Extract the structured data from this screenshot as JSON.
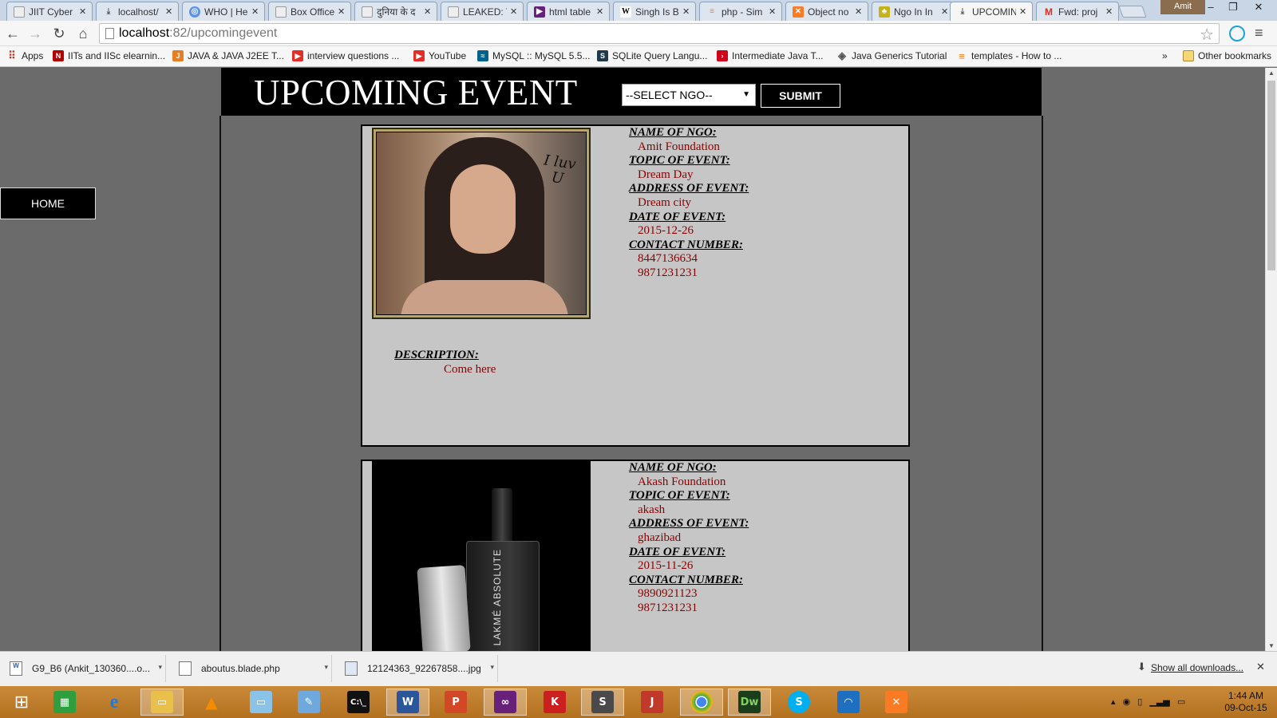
{
  "browser": {
    "tabs": [
      {
        "label": "JIIT Cyber",
        "icon": "page-icon",
        "color": "#eeeeee"
      },
      {
        "label": "localhost/",
        "icon": "download-page-icon",
        "color": "#eeeeee"
      },
      {
        "label": "WHO | He",
        "icon": "who-icon",
        "color": "#5b92e5"
      },
      {
        "label": "Box Office",
        "icon": "page-icon",
        "color": "#eeeeee"
      },
      {
        "label": "दुनिया के द",
        "icon": "page-icon",
        "color": "#eeeeee"
      },
      {
        "label": "LEAKED: T",
        "icon": "page-icon",
        "color": "#eeeeee"
      },
      {
        "label": "html table",
        "icon": "visual-studio-icon",
        "color": "#68217a"
      },
      {
        "label": "Singh Is B",
        "icon": "wikipedia-icon",
        "color": "#ffffff"
      },
      {
        "label": "php - Sim",
        "icon": "stackoverflow-icon",
        "color": "#f48024"
      },
      {
        "label": "Object no",
        "icon": "xampp-icon",
        "color": "#fb7a24"
      },
      {
        "label": "Ngo In In",
        "icon": "ngo-icon",
        "color": "#c7b21b"
      },
      {
        "label": "UPCOMIN",
        "icon": "download-page-icon",
        "color": "#eeeeee",
        "active": true
      },
      {
        "label": "Fwd: proj",
        "icon": "gmail-icon",
        "color": "#d93025"
      }
    ],
    "profile_name": "Amit",
    "url_host": "localhost",
    "url_path": ":82/upcomingevent",
    "bookmarks": [
      {
        "label": "Apps",
        "icon": "apps-grid-icon",
        "color": "#c0392b"
      },
      {
        "label": "IITs and IISc elearnin...",
        "icon": "nptel-icon",
        "color": "#b00000"
      },
      {
        "label": "JAVA & JAVA J2EE T...",
        "icon": "java-icon",
        "color": "#e67e22"
      },
      {
        "label": "interview questions ...",
        "icon": "youtube-icon",
        "color": "#e52d27"
      },
      {
        "label": "YouTube",
        "icon": "youtube-icon",
        "color": "#e52d27"
      },
      {
        "label": "MySQL :: MySQL 5.5...",
        "icon": "mysql-icon",
        "color": "#00618a"
      },
      {
        "label": "SQLite Query Langu...",
        "icon": "sqlite-icon",
        "color": "#1f3a4a"
      },
      {
        "label": "Intermediate Java T...",
        "icon": "arrow-icon",
        "color": "#d0021b"
      },
      {
        "label": "Java Generics Tutorial",
        "icon": "diamond-icon",
        "color": "#555555"
      },
      {
        "label": "templates - How to ...",
        "icon": "stackoverflow-icon",
        "color": "#f48024"
      }
    ],
    "bookmarks_overflow": "»",
    "other_bookmarks": "Other bookmarks"
  },
  "site": {
    "title": "UPCOMING EVENT",
    "select_value": "--SELECT NGO--",
    "submit_label": "SUBMIT",
    "home_label": "HOME"
  },
  "labels": {
    "ngo": "NAME OF NGO:",
    "topic": "TOPIC OF EVENT:",
    "address": "ADDRESS OF EVENT:",
    "date": "DATE OF EVENT:",
    "contact": "CONTACT NUMBER:",
    "description": "DESCRIPTION:"
  },
  "events": [
    {
      "ngo": "Amit Foundation",
      "topic": "Dream Day",
      "address": "Dream city",
      "date": "2015-12-26",
      "contact1": "8447136634",
      "contact2": "9871231231",
      "description": "Come here",
      "image_overlay_text": "I luv U"
    },
    {
      "ngo": "Akash Foundation",
      "topic": "akash",
      "address": "ghazibad",
      "date": "2015-11-26",
      "contact1": "9890921123",
      "contact2": "9871231231",
      "image_brand_text": "LAKMÉ ABSOLUTE"
    }
  ],
  "downloads": [
    {
      "label": "G9_B6 (Ankit_130360....o...",
      "icon": "word-doc-icon"
    },
    {
      "label": "aboutus.blade.php",
      "icon": "php-file-icon"
    },
    {
      "label": "12124363_92267858....jpg",
      "icon": "image-file-icon"
    }
  ],
  "show_all_downloads": "Show all downloads...",
  "taskbar": {
    "apps": [
      {
        "name": "start-button-icon",
        "glyph": "⊞",
        "color": "transparent"
      },
      {
        "name": "store-icon",
        "glyph": "🛍",
        "color": "#2e9e3e"
      },
      {
        "name": "internet-explorer-icon",
        "glyph": "e",
        "color": "#1e7bd6"
      },
      {
        "name": "file-explorer-icon",
        "glyph": "▭",
        "color": "#e8c04a"
      },
      {
        "name": "vlc-icon",
        "glyph": "▲",
        "color": "#f28c00"
      },
      {
        "name": "folder-icon",
        "glyph": "▭",
        "color": "#8bc2e8"
      },
      {
        "name": "notepad-icon",
        "glyph": "✎",
        "color": "#6fa8dc"
      },
      {
        "name": "command-prompt-icon",
        "glyph": ">_",
        "color": "#111111"
      },
      {
        "name": "word-icon",
        "glyph": "W",
        "color": "#2b579a"
      },
      {
        "name": "powerpoint-icon",
        "glyph": "P",
        "color": "#d24726"
      },
      {
        "name": "visual-studio-icon",
        "glyph": "∞",
        "color": "#68217a"
      },
      {
        "name": "kaspersky-icon",
        "glyph": "K",
        "color": "#cc2020"
      },
      {
        "name": "sublime-text-icon",
        "glyph": "S",
        "color": "#4a4a4a"
      },
      {
        "name": "pdf-reader-icon",
        "glyph": "J",
        "color": "#c0392b"
      },
      {
        "name": "chrome-icon",
        "glyph": "◉",
        "color": "#34a853"
      },
      {
        "name": "dreamweaver-icon",
        "glyph": "Dw",
        "color": "#2e7d32"
      },
      {
        "name": "skype-icon",
        "glyph": "S",
        "color": "#00aff0"
      },
      {
        "name": "wifi-icon",
        "glyph": "☰",
        "color": "#1e6fbf"
      },
      {
        "name": "xampp-icon",
        "glyph": "✕",
        "color": "#fb7a24"
      }
    ],
    "time": "1:44 AM",
    "date": "09-Oct-15"
  }
}
